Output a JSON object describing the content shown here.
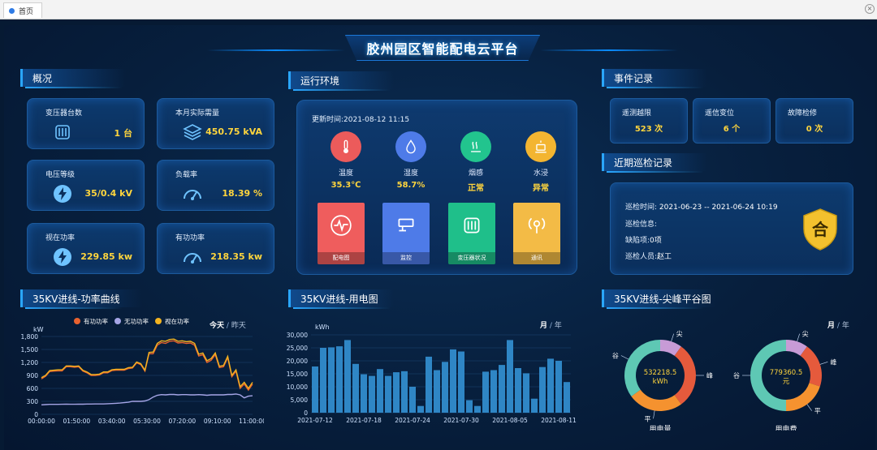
{
  "browser": {
    "tab_label": "首页",
    "close": "×"
  },
  "header": {
    "title": "胶州园区智能配电云平台"
  },
  "overview": {
    "section": "概况",
    "cards": [
      {
        "label": "变压器台数",
        "value": "1 台",
        "icon": "transformer-icon"
      },
      {
        "label": "本月实际需量",
        "value": "450.75 kVA",
        "icon": "layers-icon"
      },
      {
        "label": "电压等级",
        "value": "35/0.4 kV",
        "icon": "lightning-icon"
      },
      {
        "label": "负载率",
        "value": "18.39 %",
        "icon": "gauge-icon"
      },
      {
        "label": "视在功率",
        "value": "229.85 kw",
        "icon": "lightning-icon"
      },
      {
        "label": "有功功率",
        "value": "218.35 kw",
        "icon": "gauge-icon"
      }
    ]
  },
  "env": {
    "section": "运行环境",
    "updated": "更新时间:2021-08-12 11:15",
    "sensors": [
      {
        "label": "温度",
        "value": "35.3℃",
        "color": "#ec5b5b",
        "icon": "thermometer-icon"
      },
      {
        "label": "湿度",
        "value": "58.7%",
        "color": "#4e7be8",
        "icon": "droplet-icon"
      },
      {
        "label": "烟感",
        "value": "正常",
        "color": "#22c48e",
        "icon": "smoke-icon"
      },
      {
        "label": "水浸",
        "value": "异常",
        "color": "#f3b531",
        "icon": "water-alarm-icon"
      }
    ],
    "tiles": [
      {
        "label": "配电图",
        "color": "#ef5d5d",
        "icon": "waveform-icon"
      },
      {
        "label": "监控",
        "color": "#4e7be8",
        "icon": "camera-icon"
      },
      {
        "label": "变压器状况",
        "color": "#1fbf8a",
        "icon": "transformer-icon"
      },
      {
        "label": "通讯",
        "color": "#f3bb46",
        "icon": "signal-icon"
      }
    ]
  },
  "events": {
    "section": "事件记录",
    "items": [
      {
        "label": "遥测越限",
        "value": "523 次"
      },
      {
        "label": "遥信变位",
        "value": "6 个"
      },
      {
        "label": "故障检修",
        "value": "0 次"
      }
    ]
  },
  "inspection": {
    "section": "近期巡检记录",
    "time_label": "巡检时间:",
    "time_value": "2021-06-23 -- 2021-06-24 10:19",
    "info_label": "巡检信息:",
    "info_value": "",
    "defect_label": "缺陷项:",
    "defect_value": "0项",
    "person_label": "巡检人员:",
    "person_value": "赵工",
    "badge": "合"
  },
  "power_curve": {
    "section": "35KV进线-功率曲线",
    "toggle_today": "今天",
    "toggle_sep": "/",
    "toggle_yesterday": "昨天"
  },
  "usage": {
    "section": "35KV进线-用电图",
    "toggle_month": "月",
    "toggle_sep": "/",
    "toggle_year": "年"
  },
  "peak": {
    "section": "35KV进线-尖峰平谷图",
    "toggle_month": "月",
    "toggle_sep": "/",
    "toggle_year": "年"
  },
  "chart_data": [
    {
      "type": "line",
      "ylabel": "kW",
      "ylim": [
        0,
        1800
      ],
      "yticks": [
        "0",
        "300",
        "600",
        "900",
        "1,200",
        "1,500",
        "1,800"
      ],
      "xticks": [
        "00:00:00",
        "01:50:00",
        "03:40:00",
        "05:30:00",
        "07:20:00",
        "09:10:00",
        "11:00:00"
      ],
      "legend": "top",
      "series": [
        {
          "name": "有功功率",
          "color": "#e8622f",
          "values": [
            820,
            880,
            990,
            1000,
            1005,
            1005,
            1100,
            1100,
            1090,
            1100,
            1000,
            960,
            900,
            900,
            910,
            960,
            960,
            1010,
            1020,
            1020,
            1020,
            1060,
            1070,
            1190,
            1150,
            1000,
            1400,
            1400,
            1600,
            1660,
            1640,
            1690,
            1700,
            1650,
            1660,
            1640,
            1650,
            1600,
            1350,
            1380,
            1200,
            1250,
            1380,
            1080,
            1100,
            1310,
            870,
            1000,
            600,
            700,
            560,
            700
          ]
        },
        {
          "name": "无功功率",
          "color": "#a5a5e6",
          "values": [
            220,
            225,
            230,
            230,
            230,
            232,
            235,
            232,
            232,
            235,
            235,
            238,
            238,
            240,
            240,
            240,
            245,
            250,
            255,
            260,
            270,
            280,
            300,
            300,
            300,
            310,
            340,
            400,
            440,
            455,
            450,
            460,
            460,
            450,
            455,
            455,
            450,
            450,
            455,
            450,
            440,
            450,
            450,
            450,
            450,
            460,
            460,
            470,
            450,
            380,
            420,
            430
          ]
        },
        {
          "name": "视在功率",
          "color": "#f2b320",
          "values": [
            850,
            900,
            1010,
            1020,
            1030,
            1030,
            1120,
            1120,
            1110,
            1120,
            1020,
            980,
            920,
            920,
            930,
            980,
            980,
            1030,
            1040,
            1040,
            1040,
            1080,
            1090,
            1210,
            1170,
            1020,
            1430,
            1440,
            1640,
            1700,
            1690,
            1730,
            1740,
            1690,
            1700,
            1680,
            1690,
            1640,
            1390,
            1420,
            1240,
            1290,
            1420,
            1110,
            1130,
            1340,
            900,
            1030,
            640,
            740,
            600,
            740
          ]
        }
      ]
    },
    {
      "type": "bar",
      "ylabel": "kWh",
      "ylim": [
        0,
        30000
      ],
      "yticks": [
        "0",
        "5,000",
        "10,000",
        "15,000",
        "20,000",
        "25,000",
        "30,000"
      ],
      "xticks": [
        "2021-07-12",
        "2021-07-18",
        "2021-07-24",
        "2021-07-30",
        "2021-08-05",
        "2021-08-11"
      ],
      "color": "#2f86c5",
      "values": [
        17800,
        25000,
        25200,
        25600,
        28000,
        18800,
        14800,
        14200,
        16800,
        14200,
        15600,
        16000,
        10000,
        2600,
        21600,
        16400,
        19600,
        24400,
        23600,
        4800,
        2600,
        15800,
        16400,
        18400,
        28000,
        17200,
        15200,
        5400,
        17600,
        20800,
        20000,
        11800
      ]
    },
    {
      "type": "pie",
      "name": "用电量",
      "center_value": "532218.5",
      "center_unit": "kWh",
      "slice_labels": [
        "尖",
        "峰",
        "平",
        "谷"
      ],
      "colors": [
        "#c79bd6",
        "#e55a3c",
        "#f5922f",
        "#5ec8b4"
      ],
      "values": [
        0.1,
        0.3,
        0.25,
        0.35
      ]
    },
    {
      "type": "pie",
      "name": "用电费",
      "center_value": "779360.5",
      "center_unit": "元",
      "slice_labels": [
        "尖",
        "峰",
        "平",
        "谷"
      ],
      "colors": [
        "#c79bd6",
        "#e55a3c",
        "#f5922f",
        "#5ec8b4"
      ],
      "values": [
        0.1,
        0.2,
        0.2,
        0.5
      ]
    }
  ]
}
